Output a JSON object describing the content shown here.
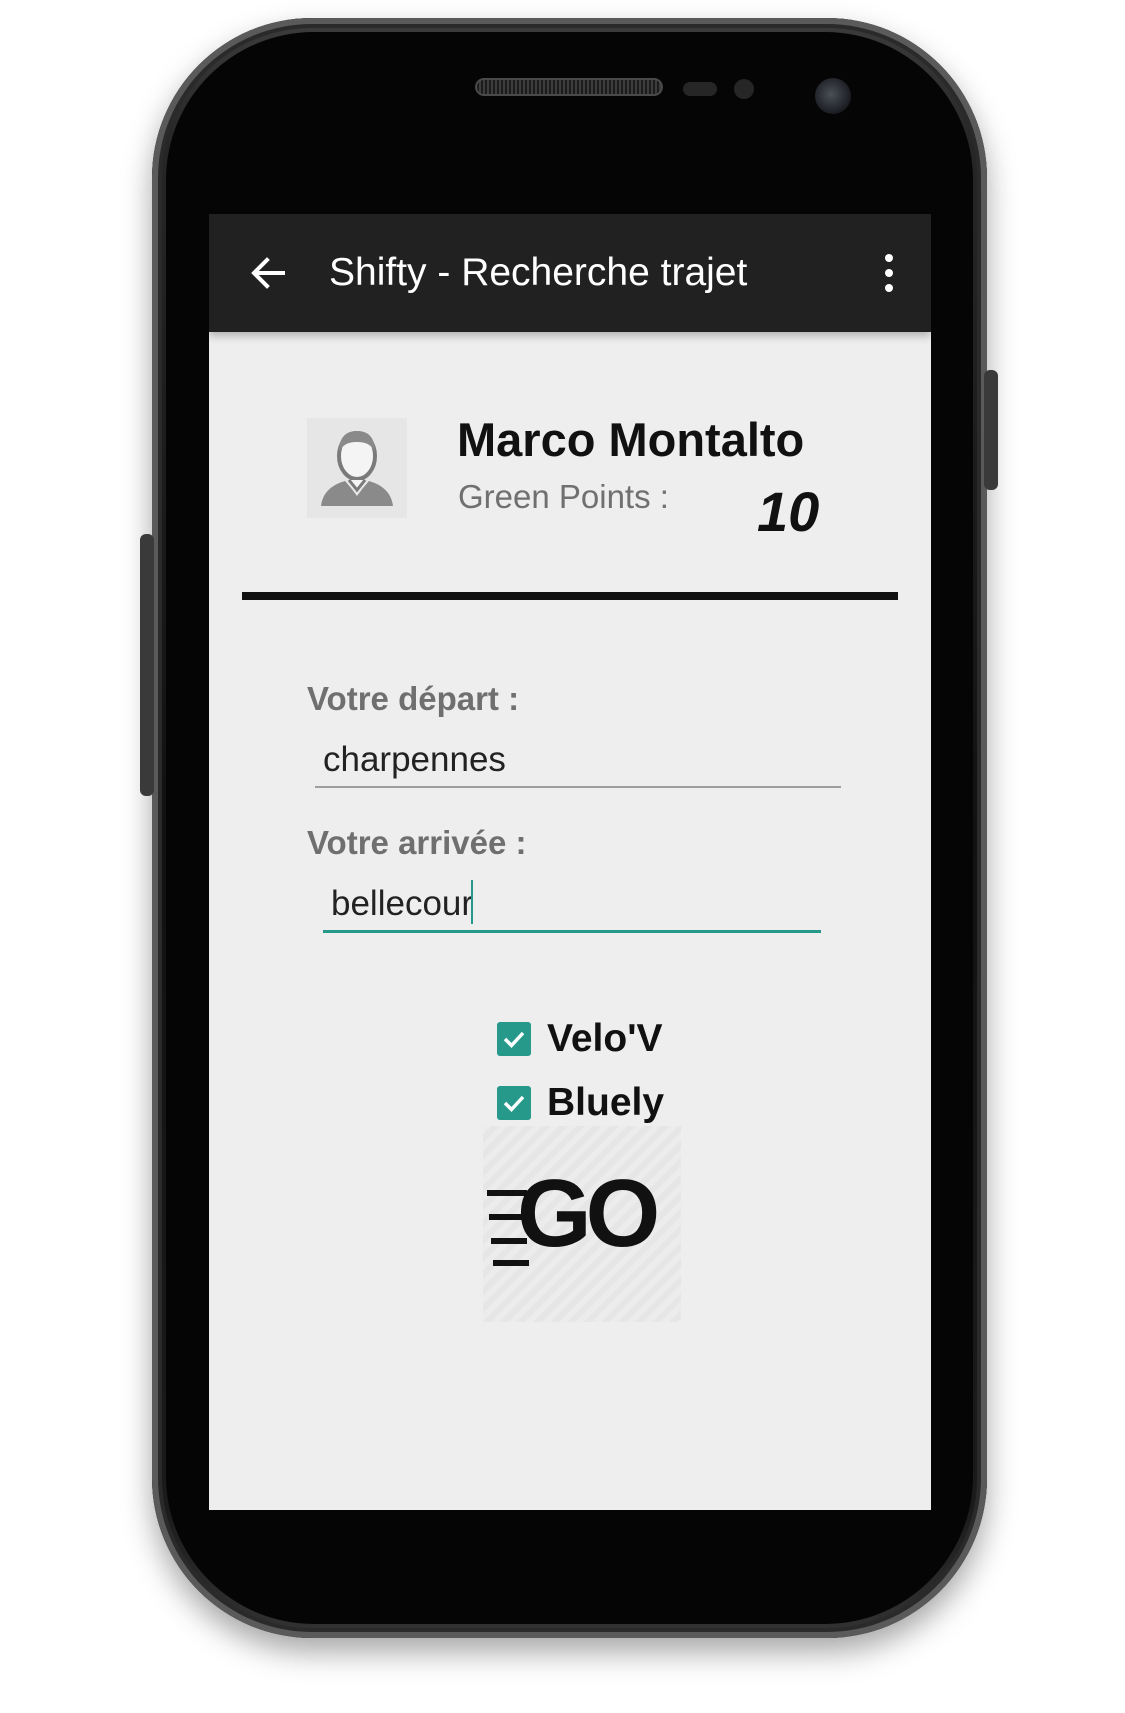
{
  "app_bar": {
    "title": "Shifty - Recherche trajet",
    "back_icon": "arrow-left-icon",
    "menu_icon": "more-vertical-icon"
  },
  "profile": {
    "avatar_icon": "user-avatar-icon",
    "name": "Marco Montalto",
    "points_label": "Green Points :",
    "points_value": "10"
  },
  "form": {
    "departure_label": "Votre départ :",
    "departure_value": "charpennes",
    "arrival_label": "Votre arrivée :",
    "arrival_value": "bellecour"
  },
  "options": [
    {
      "label": "Velo'V",
      "checked": true
    },
    {
      "label": "Bluely",
      "checked": true
    }
  ],
  "go_button": {
    "label": "GO"
  },
  "colors": {
    "accent": "#26998a",
    "app_bar": "#212121",
    "background": "#eeeeee"
  }
}
